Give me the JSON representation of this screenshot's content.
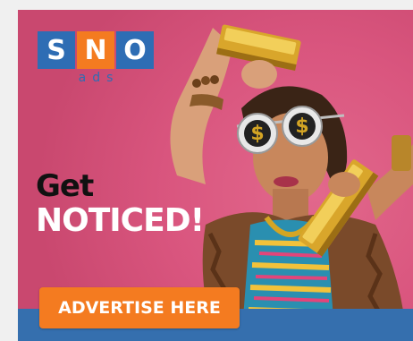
{
  "ad": {
    "logo": {
      "letters": [
        "S",
        "N",
        "O"
      ],
      "subtitle": "ads"
    },
    "headline_line1": "Get",
    "headline_line2": "NOTICED!",
    "cta_label": "ADVERTISE HERE"
  },
  "colors": {
    "background_pink": "#d9557e",
    "logo_blue": "#2e6db4",
    "accent_orange": "#f47b20",
    "bottom_band_blue": "#356fae"
  },
  "icons": [
    "dollar-sunglasses-icon",
    "gold-bar-icon"
  ]
}
